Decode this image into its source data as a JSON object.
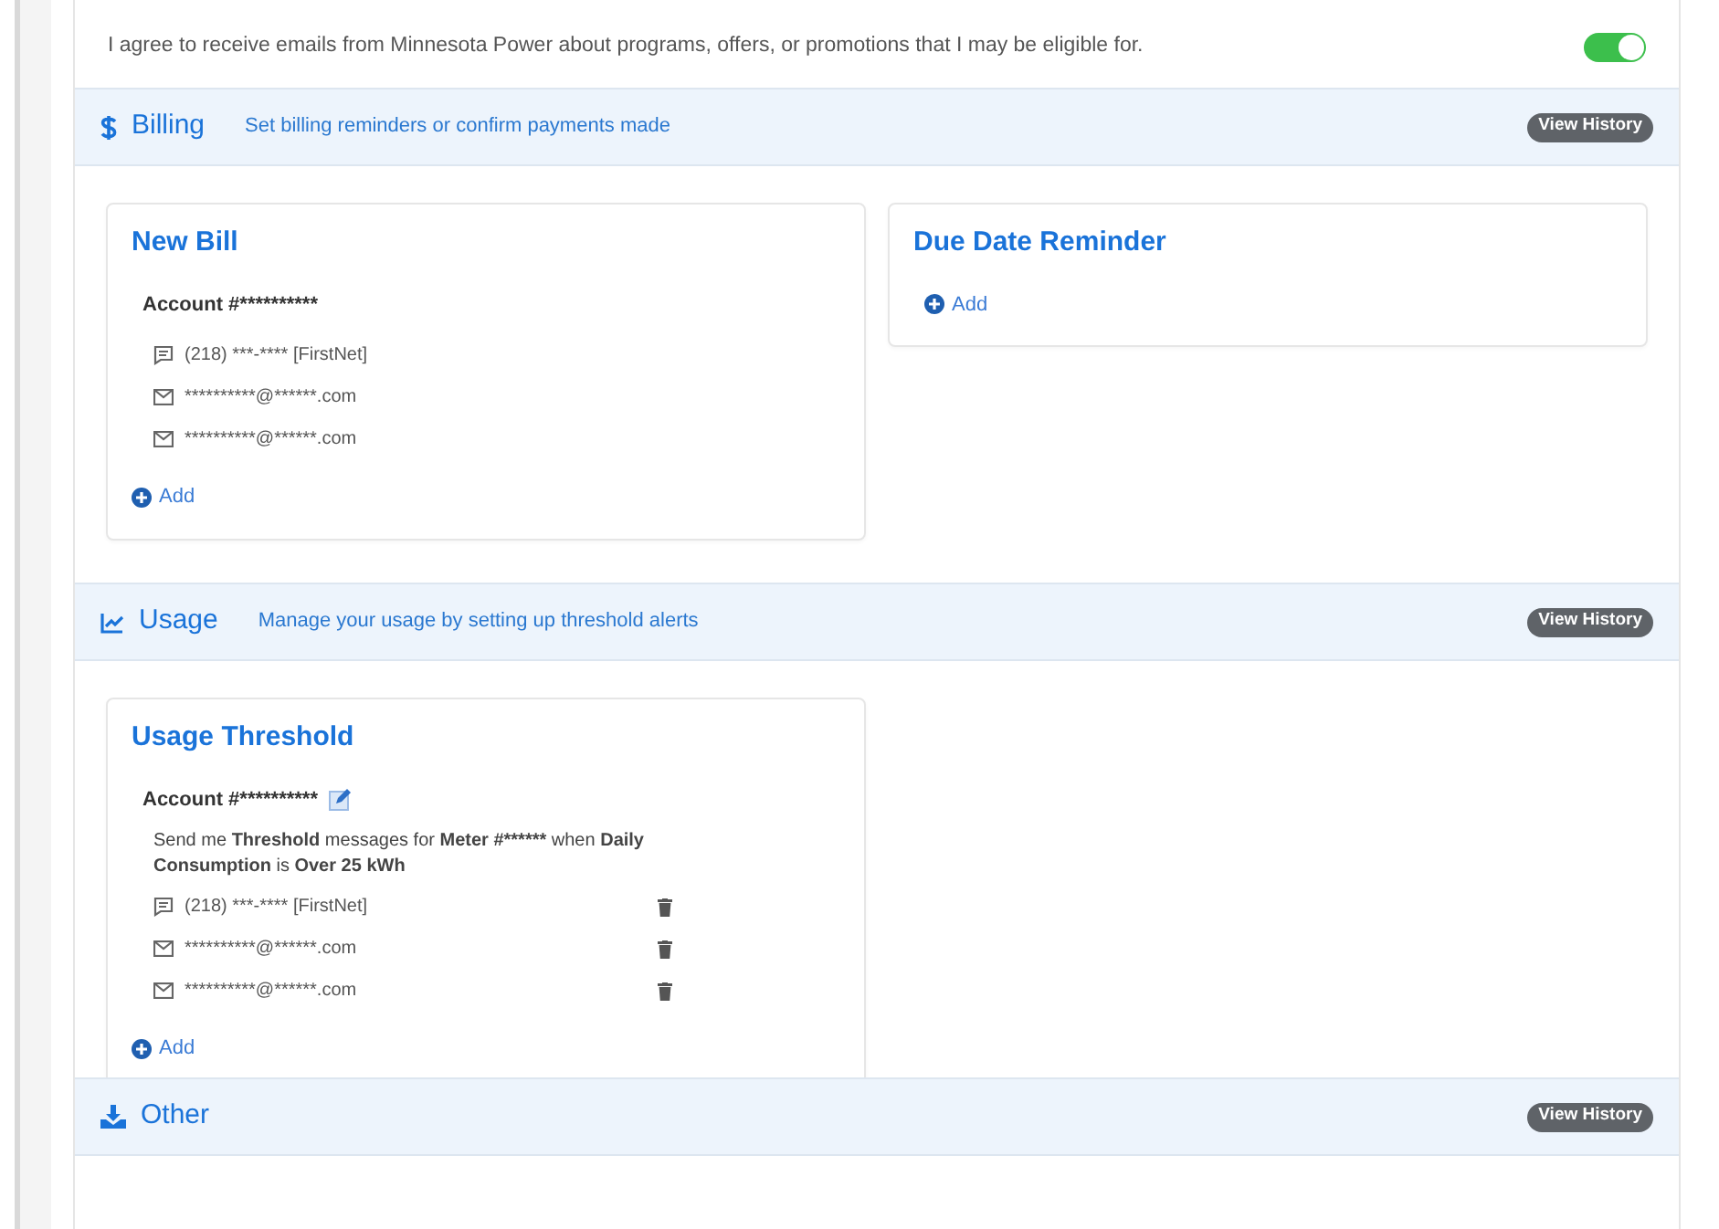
{
  "consent": {
    "text": "I agree to receive emails from Minnesota Power about programs, offers, or promotions that I may be eligible for.",
    "on": true
  },
  "sections": [
    {
      "kind": "billing",
      "title": "Billing",
      "subtitle": "Set billing reminders or confirm payments made",
      "history_button": "View History",
      "cards": [
        {
          "title": "New Bill",
          "account": "Account #**********",
          "editable": false,
          "contacts": [
            {
              "kind": "sms",
              "text": "(218) ***-**** [FirstNet]",
              "deletable": false
            },
            {
              "kind": "email",
              "text": "**********@******.com",
              "deletable": false
            },
            {
              "kind": "email",
              "text": "**********@******.com",
              "deletable": false
            }
          ],
          "add": "Add"
        },
        {
          "title": "Due Date Reminder",
          "add": "Add"
        }
      ]
    },
    {
      "kind": "usage",
      "title": "Usage",
      "subtitle": "Manage your usage by setting up threshold alerts",
      "history_button": "View History",
      "cards": [
        {
          "title": "Usage Threshold",
          "account": "Account #**********",
          "editable": true,
          "description": [
            {
              "text": "Send me ",
              "bold": false
            },
            {
              "text": "Threshold",
              "bold": true
            },
            {
              "text": " messages for ",
              "bold": false
            },
            {
              "text": "Meter #******",
              "bold": true
            },
            {
              "text": " when ",
              "bold": false
            },
            {
              "text": "Daily Consumption",
              "bold": true
            },
            {
              "text": " is ",
              "bold": false
            },
            {
              "text": "Over 25 kWh",
              "bold": true
            }
          ],
          "contacts": [
            {
              "kind": "sms",
              "text": "(218) ***-**** [FirstNet]",
              "deletable": true
            },
            {
              "kind": "email",
              "text": "**********@******.com",
              "deletable": true
            },
            {
              "kind": "email",
              "text": "**********@******.com",
              "deletable": true
            }
          ],
          "add": "Add"
        }
      ]
    },
    {
      "kind": "other",
      "title": "Other",
      "history_button": "View History"
    }
  ]
}
